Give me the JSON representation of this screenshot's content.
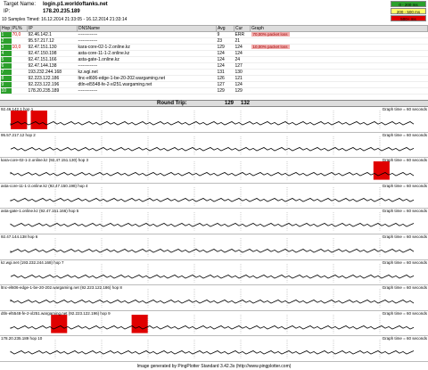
{
  "header": {
    "target_label": "Target Name:",
    "target": "login.p1.worldoftanks.net",
    "ip_label": "IP:",
    "ip": "178.20.235.189",
    "samples": "10 Samples Timed: 16.12.2014 21:33:05 - 16.12.2014 21:33:14"
  },
  "legend": {
    "items": [
      {
        "label": "0 - 200 ms",
        "color": "#2ca02c"
      },
      {
        "label": "200 - 500 ms",
        "color": "#ffff66"
      },
      {
        "label": "500+ ms",
        "color": "#e00000"
      }
    ]
  },
  "table": {
    "headers": [
      "Hop",
      "PL%",
      "IP",
      "DNSName",
      "Avg",
      "Cur",
      "Graph"
    ],
    "rows": [
      {
        "hop": "1",
        "pl": "70,0",
        "ip": "92.46.142.1",
        "dns": "-------------",
        "avg": "9",
        "cur": "ERR"
      },
      {
        "hop": "2",
        "pl": "",
        "ip": "95.57.217.12",
        "dns": "-------------",
        "avg": "23",
        "cur": "21"
      },
      {
        "hop": "3",
        "pl": "10,0",
        "ip": "92.47.151.130",
        "dns": "kara-core-02-1-2.online.kz",
        "avg": "129",
        "cur": "124"
      },
      {
        "hop": "4",
        "pl": "",
        "ip": "92.47.150.198",
        "dns": "asta-core-11-1-2.online.kz",
        "avg": "124",
        "cur": "124"
      },
      {
        "hop": "5",
        "pl": "",
        "ip": "92.47.151.166",
        "dns": "asta-gate-1.online.kz",
        "avg": "124",
        "cur": "24"
      },
      {
        "hop": "6",
        "pl": "",
        "ip": "92.47.144.138",
        "dns": "-------------",
        "avg": "124",
        "cur": "127"
      },
      {
        "hop": "7",
        "pl": "",
        "ip": "193.232.244.168",
        "dns": "kz.wgi.net",
        "avg": "131",
        "cur": "130"
      },
      {
        "hop": "8",
        "pl": "",
        "ip": "92.223.122.186",
        "dns": "ltnc-el606-edge-1-be-20-202.wargaming.net",
        "avg": "126",
        "cur": "121"
      },
      {
        "hop": "9",
        "pl": "",
        "ip": "92.223.122.196",
        "dns": "dtln-el5548-fe-2-xl251.wargaming.net",
        "avg": "127",
        "cur": "124"
      },
      {
        "hop": "10",
        "pl": "",
        "ip": "178.20.235.189",
        "dns": "-------------",
        "avg": "129",
        "cur": "129"
      }
    ],
    "graph_notes": [
      "70,00% packet loss",
      "10,00% packet loss"
    ]
  },
  "round_trip": {
    "label": "Round Trip:",
    "avg": "129",
    "cur": "132"
  },
  "graphs": [
    {
      "title": "92.46.142.1 hop 1",
      "right": "Graph time = 60 seconds",
      "loss": [
        0,
        1,
        0,
        0,
        1,
        1,
        1,
        0,
        1,
        1,
        0,
        1,
        1,
        0,
        1,
        0,
        0,
        1,
        1,
        1
      ]
    },
    {
      "title": "95.57.217.12 hop 2",
      "right": "Graph time = 60 seconds",
      "loss": []
    },
    {
      "title": "kara-core-02-1-2.online.kz (92.47.151.130) hop 3",
      "right": "Graph time = 60 seconds",
      "loss": [
        18
      ]
    },
    {
      "title": "asta-core-11-1-2.online.kz (92.47.150.198) hop 4",
      "right": "Graph time = 60 seconds",
      "loss": []
    },
    {
      "title": "asta-gate-1.online.kz (92.47.151.166) hop 5",
      "right": "Graph time = 60 seconds",
      "loss": []
    },
    {
      "title": "92.47.144.138 hop 6",
      "right": "Graph time = 60 seconds",
      "loss": []
    },
    {
      "title": "kz.wgi.net (193.232.244.168) hop 7",
      "right": "Graph time = 60 seconds",
      "loss": []
    },
    {
      "title": "ltnc-el606-edge-1-be-20-202.wargaming.net (92.223.122.186) hop 8",
      "right": "Graph time = 60 seconds",
      "loss": []
    },
    {
      "title": "dtln-el5548-fe-2-xl251.wargaming.net (92.223.122.196) hop 9",
      "right": "Graph time = 60 seconds",
      "loss": [
        2,
        6
      ]
    },
    {
      "title": "178.20.235.189 hop 10",
      "right": "Graph time = 60 seconds",
      "loss": []
    }
  ],
  "footer": "Image generated by PingPlotter Standard 3.42.3s (http://www.pingplotter.com)"
}
